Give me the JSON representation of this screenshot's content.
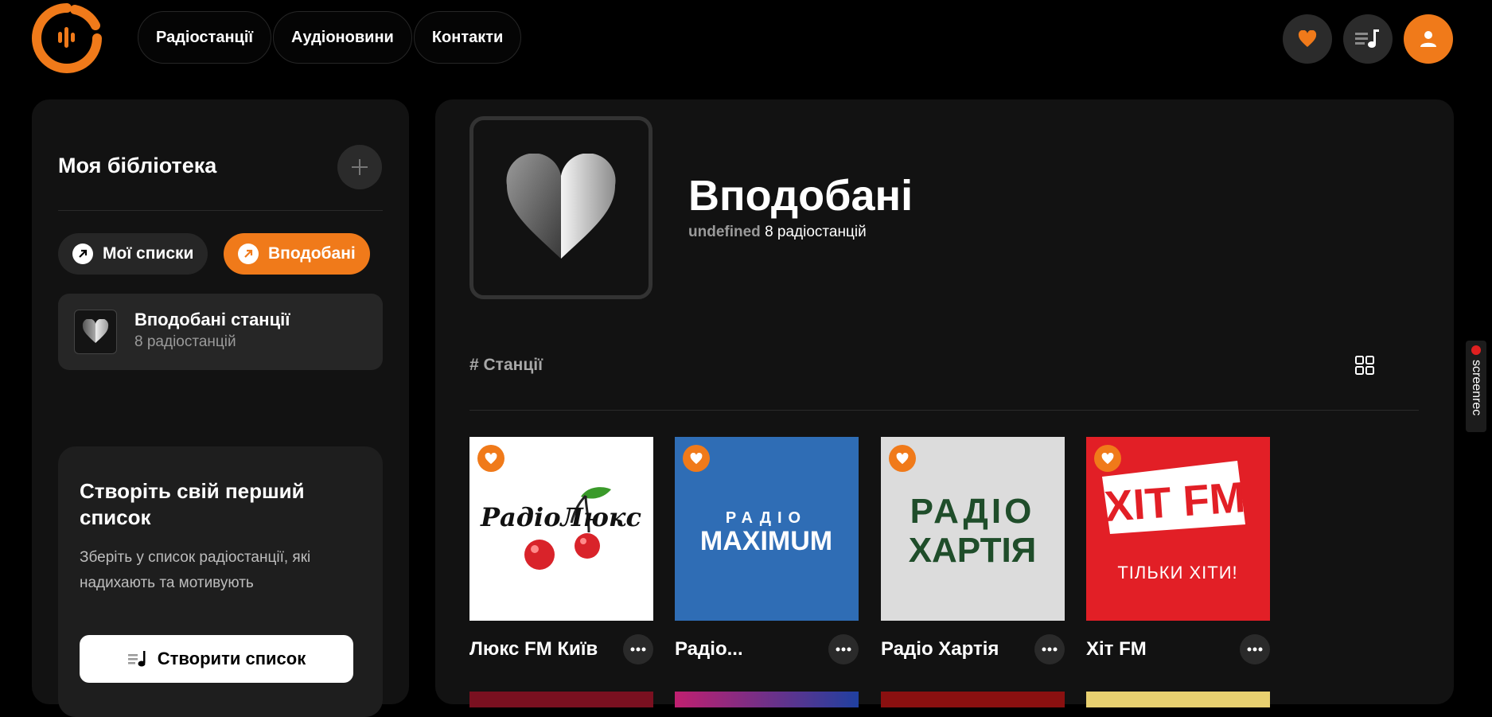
{
  "brand": {
    "accent": "#f07a1a",
    "logo_icon": "radio-wave-logo-icon"
  },
  "nav": {
    "items": [
      {
        "label": "Радіостанції"
      },
      {
        "label": "Аудіоновини"
      },
      {
        "label": "Контакти"
      }
    ]
  },
  "header_actions": {
    "favorites_icon": "heart-icon",
    "queue_icon": "playlist-icon",
    "profile_icon": "user-icon"
  },
  "library": {
    "title": "Моя бібліотека",
    "add_icon": "plus-icon",
    "tabs": [
      {
        "label": "Мої списки",
        "active": false
      },
      {
        "label": "Вподобані",
        "active": true
      }
    ],
    "items": [
      {
        "title": "Вподобані станції",
        "subtitle": "8 радіостанцій"
      }
    ]
  },
  "promo": {
    "title": "Створіть свій перший список",
    "text": "Зберіть у список радіостанції, які надихають та мотивують",
    "button_label": "Створити список"
  },
  "main": {
    "title": "Вподобані",
    "owner": "undefined",
    "count": "8 радіостанцій",
    "section_label": "# Станції",
    "view_icon": "grid-view-icon"
  },
  "stations": [
    {
      "name": "Люкс FM Київ",
      "logo_top": "РадіоЛюкс",
      "favorite": true
    },
    {
      "name": "Радіо...",
      "logo_top": "РАДІО",
      "logo_bottom": "MAXIMUM",
      "favorite": true
    },
    {
      "name": "Радіо Хартія",
      "logo_top": "РАДІО",
      "logo_bottom": "ХАРТІЯ",
      "favorite": true
    },
    {
      "name": "Хіт FM",
      "logo_top": "ХІТ FM",
      "logo_bottom": "ТІЛЬКИ ХІТИ!",
      "favorite": true
    }
  ],
  "overlay": {
    "recorder_label": "screenrec"
  }
}
